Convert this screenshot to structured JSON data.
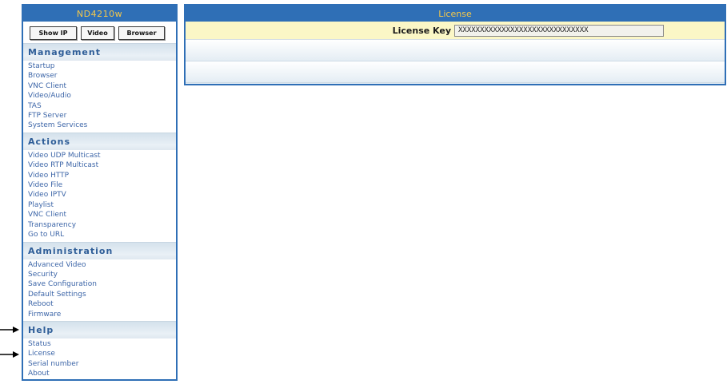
{
  "sidebar": {
    "device_name": "ND4210w",
    "buttons": {
      "show_ip": "Show IP",
      "video": "Video",
      "browser": "Browser"
    },
    "sections": {
      "management": {
        "title": "Management",
        "items": [
          "Startup",
          "Browser",
          "VNC Client",
          "Video/Audio",
          "TAS",
          "FTP Server",
          "System Services"
        ]
      },
      "actions": {
        "title": "Actions",
        "items": [
          "Video UDP Multicast",
          "Video RTP Multicast",
          "Video HTTP",
          "Video File",
          "Video IPTV",
          "Playlist",
          "VNC Client",
          "Transparency",
          "Go to URL"
        ]
      },
      "administration": {
        "title": "Administration",
        "items": [
          "Advanced Video",
          "Security",
          "Save Configuration",
          "Default Settings",
          "Reboot",
          "Firmware"
        ]
      },
      "help": {
        "title": "Help",
        "items": [
          "Status",
          "License",
          "Serial number",
          "About"
        ]
      }
    }
  },
  "panel": {
    "title": "License",
    "license_key_label": "License Key",
    "license_key_value": "XXXXXXXXXXXXXXXXXXXXXXXXXXXXXX"
  },
  "colors": {
    "header_blue": "#2f6fb6",
    "header_text": "#f5c84a",
    "link_blue": "#3d66a8",
    "license_row_bg": "#fbf7c6"
  }
}
